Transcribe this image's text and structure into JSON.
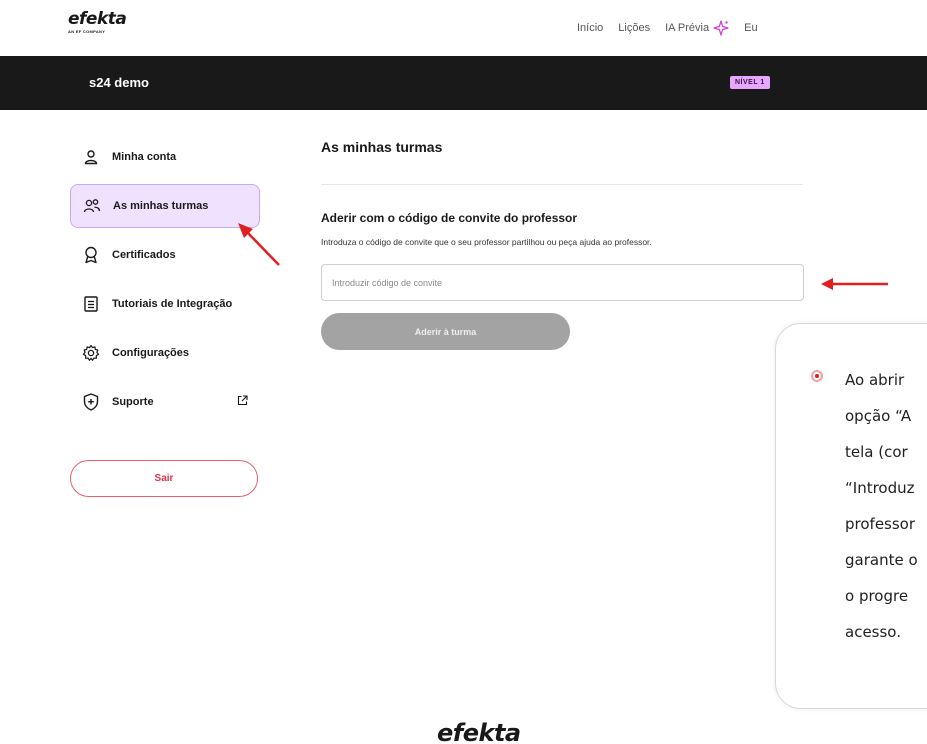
{
  "brand": {
    "logo_text": "efekta",
    "logo_sub": "AN EF COMPANY"
  },
  "topnav": {
    "items": [
      "Início",
      "Lições"
    ],
    "ai_label": "IA Prévia",
    "profile_label": "Eu"
  },
  "course": {
    "name": "s24 demo",
    "level_badge": "NÍVEL 1"
  },
  "sidebar": {
    "items": [
      {
        "label": "Minha conta",
        "icon": "user-icon"
      },
      {
        "label": "As minhas turmas",
        "icon": "users-icon",
        "active": true
      },
      {
        "label": "Certificados",
        "icon": "award-icon"
      },
      {
        "label": "Tutoriais de Integração",
        "icon": "document-icon"
      },
      {
        "label": "Configurações",
        "icon": "gear-icon"
      },
      {
        "label": "Suporte",
        "icon": "shield-plus-icon",
        "external": true
      }
    ],
    "logout_label": "Sair"
  },
  "main": {
    "title": "As minhas turmas",
    "section_title": "Aderir com o código de convite do professor",
    "section_desc": "Introduza o código de convite que o seu professor partilhou ou peça ajuda ao professor.",
    "input_value": "",
    "input_placeholder": "Introduzir código de convite",
    "join_label": "Aderir à turma"
  },
  "callout": {
    "lines": [
      "Ao abrir",
      "opção “A",
      "tela (cor",
      "“Introduz",
      "professor",
      "garante o",
      "o progre",
      "acesso."
    ]
  },
  "colors": {
    "accent": "#e6a8ff",
    "active_bg": "#efe2ff",
    "danger": "#e0334a",
    "dark_bar": "#191919",
    "arrow": "#e02020"
  }
}
